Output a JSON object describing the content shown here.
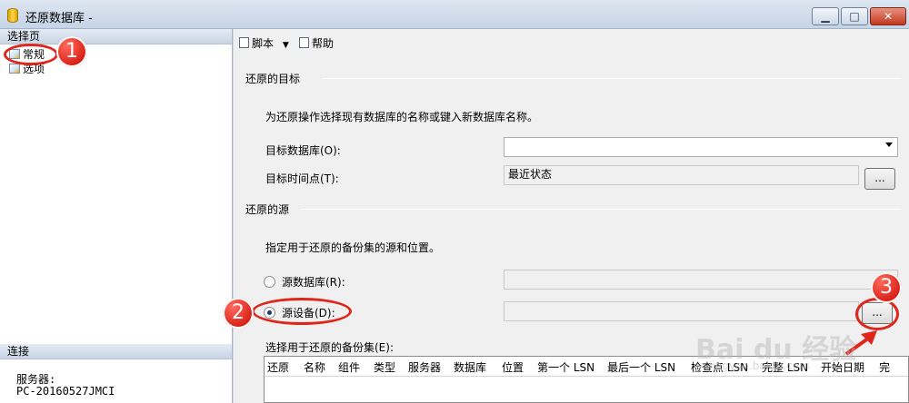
{
  "window": {
    "title": "还原数据库 -",
    "minimize": "▁",
    "maximize": "□",
    "close": "✕"
  },
  "left": {
    "select_page_header": "选择页",
    "nav_items": [
      "常规",
      "选项"
    ],
    "connect_header": "连接",
    "server_label": "服务器:",
    "server_value": "PC-20160527JMCI"
  },
  "toolbar": {
    "script": "脚本",
    "script_arrow": "▼",
    "help": "帮助"
  },
  "target": {
    "group_title": "还原的目标",
    "description": "为还原操作选择现有数据库的名称或键入新数据库名称。",
    "db_label": "目标数据库(O):",
    "db_value": "",
    "time_label": "目标时间点(T):",
    "time_value": "最近状态",
    "browse": "..."
  },
  "source": {
    "group_title": "还原的源",
    "description": "指定用于还原的备份集的源和位置。",
    "from_db_label": "源数据库(R):",
    "from_device_label": "源设备(D):",
    "browse": "...",
    "selected": "from_device"
  },
  "backup_sets": {
    "label": "选择用于还原的备份集(E):",
    "columns": [
      "还原",
      "名称",
      "组件",
      "类型",
      "服务器",
      "数据库",
      "位置",
      "第一个 LSN",
      "最后一个 LSN",
      "检查点 LSN",
      "完整 LSN",
      "开始日期",
      "完"
    ]
  },
  "annotations": [
    "1",
    "2",
    "3"
  ],
  "watermark": {
    "text": "Bai du 经验",
    "sub": "jingyan.baidu.com"
  },
  "colors": {
    "annotation": "#e0261b",
    "title_bar": "#c6d4e6",
    "panel_header": "#c9d5e5"
  }
}
